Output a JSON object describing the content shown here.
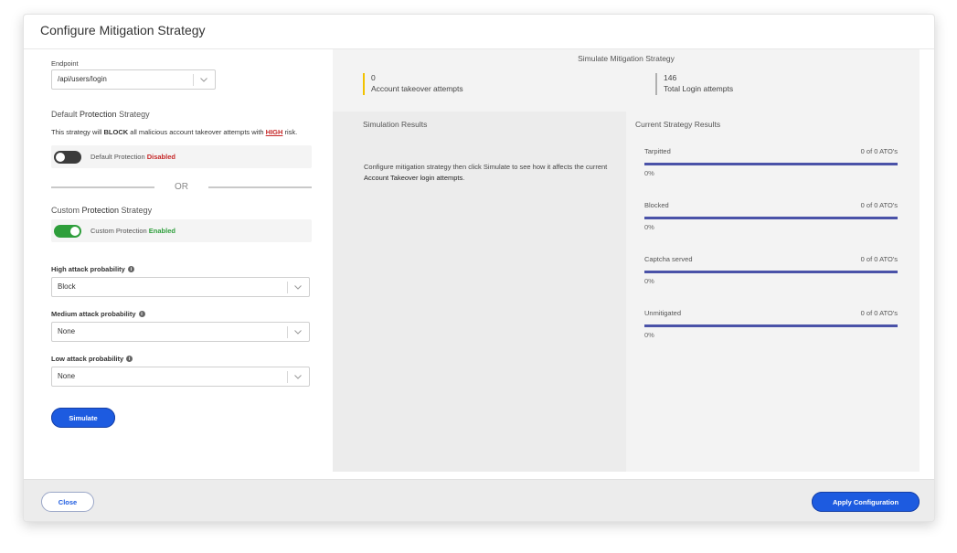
{
  "modal": {
    "title": "Configure Mitigation Strategy"
  },
  "endpoint": {
    "label": "Endpoint",
    "value": "/api/users/login"
  },
  "default_strategy": {
    "title_prefix": "Default ",
    "title_bold": "Protection",
    "title_suffix": " Strategy",
    "desc_1": "This strategy will ",
    "desc_bold": "BLOCK",
    "desc_2": " all malicious account takeover attempts with ",
    "desc_high": "HIGH",
    "desc_3": " risk.",
    "toggle_label": "Default Protection ",
    "toggle_state": "Disabled",
    "enabled": false
  },
  "or_text": "OR",
  "custom_strategy": {
    "title_prefix": "Custom ",
    "title_bold": "Protection",
    "title_suffix": " Strategy",
    "toggle_label": "Custom Protection ",
    "toggle_state": "Enabled",
    "enabled": true
  },
  "probabilities": [
    {
      "label": "High attack probability",
      "value": "Block"
    },
    {
      "label": "Medium attack probability",
      "value": "None"
    },
    {
      "label": "Low attack probability",
      "value": "None"
    }
  ],
  "simulate_label": "Simulate",
  "simulation": {
    "title": "Simulate Mitigation Strategy",
    "stats": [
      {
        "value": "0",
        "label": "Account takeover attempts",
        "color": "#f2c200"
      },
      {
        "value": "146",
        "label": "Total Login attempts",
        "color": "#b0b0b0"
      }
    ],
    "results_title": "Simulation Results",
    "results_text_1": "Configure mitigation strategy then click Simulate to see how it affects the current ",
    "results_text_bold": "Account Takeover login attempts",
    "results_text_2": ".",
    "current_title": "Current Strategy Results",
    "current": [
      {
        "name": "Tarpitted",
        "count": "0 of 0 ATO's",
        "pct": "0%",
        "fill": 1.0
      },
      {
        "name": "Blocked",
        "count": "0 of 0 ATO's",
        "pct": "0%",
        "fill": 1.0
      },
      {
        "name": "Captcha served",
        "count": "0 of 0 ATO's",
        "pct": "0%",
        "fill": 1.0
      },
      {
        "name": "Unmitigated",
        "count": "0 of 0 ATO's",
        "pct": "0%",
        "fill": 1.0
      }
    ]
  },
  "footer": {
    "close_label": "Close",
    "apply_label": "Apply Configuration"
  },
  "colors": {
    "primary": "#1d5be0",
    "danger": "#c62828",
    "success": "#2e9e3b",
    "bar": "#4a52a8"
  }
}
